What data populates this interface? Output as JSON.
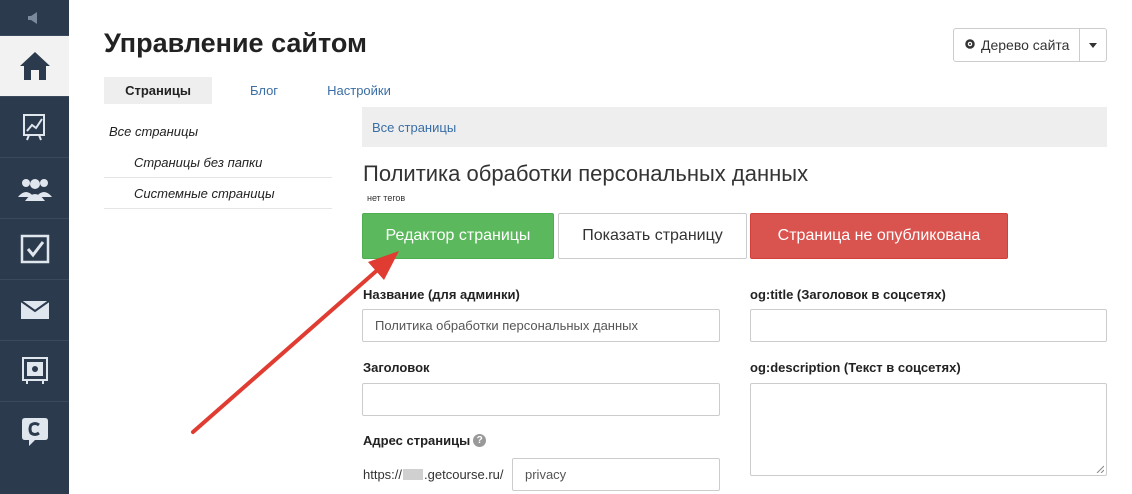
{
  "sidebar": {
    "items": [
      {
        "icon": "megaphone-icon"
      },
      {
        "icon": "home-icon",
        "active": true
      },
      {
        "icon": "chart-icon"
      },
      {
        "icon": "users-icon"
      },
      {
        "icon": "checkbox-icon"
      },
      {
        "icon": "mail-icon"
      },
      {
        "icon": "safe-icon"
      },
      {
        "icon": "chat-icon"
      }
    ]
  },
  "header": {
    "title": "Управление сайтом",
    "tree_button": "Дерево сайта"
  },
  "tabs": [
    {
      "label": "Страницы",
      "active": true
    },
    {
      "label": "Блог"
    },
    {
      "label": "Настройки"
    }
  ],
  "tree": {
    "root": "Все страницы",
    "children": [
      "Страницы без папки",
      "Системные страницы"
    ]
  },
  "breadcrumb": "Все страницы",
  "page": {
    "title": "Политика обработки персональных данных",
    "tags": "нет тегов",
    "buttons": {
      "edit": "Редактор страницы",
      "show": "Показать страницу",
      "unpublished": "Страница не опубликована"
    }
  },
  "form": {
    "name_label": "Название (для админки)",
    "name_value": "Политика обработки персональных данных",
    "heading_label": "Заголовок",
    "heading_value": "",
    "address_label": "Адрес страницы",
    "address_prefix_start": "https://",
    "address_prefix_end": ".getcourse.ru/",
    "address_value": "privacy",
    "og_title_label": "og:title (Заголовок в соцсетях)",
    "og_title_value": "",
    "og_desc_label": "og:description (Текст в соцсетях)"
  },
  "colors": {
    "sidebar": "#2b3a4c",
    "edit": "#5cb85c",
    "unpublished": "#d9534f",
    "arrow": "#e03c31",
    "link": "#3a6ea5"
  }
}
